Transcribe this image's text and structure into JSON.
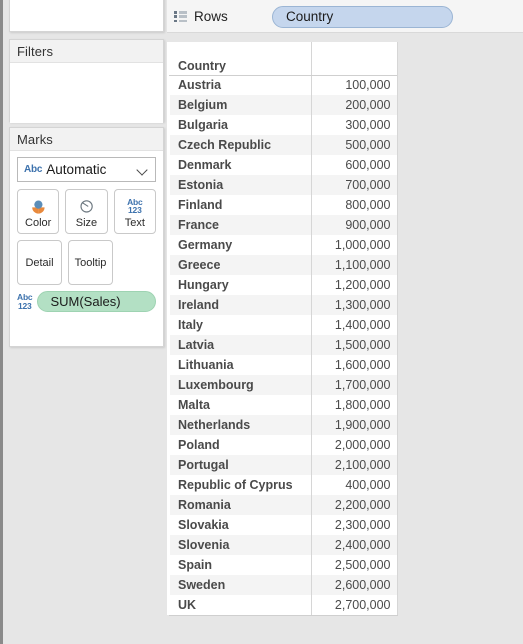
{
  "left_panel": {
    "pages_card": {
      "title": ""
    },
    "filters_card": {
      "title": "Filters"
    },
    "marks_card": {
      "title": "Marks",
      "mark_type": {
        "icon_label": "Abc",
        "value": "Automatic",
        "chevron": "chevron-down-icon"
      },
      "buttons": [
        {
          "name": "color",
          "label": "Color",
          "icon": "color-palette-icon"
        },
        {
          "name": "size",
          "label": "Size",
          "icon": "size-circle-icon"
        },
        {
          "name": "text",
          "label": "Text",
          "icon": "abc123-icon",
          "icon_line1": "Abc",
          "icon_line2": "123"
        },
        {
          "name": "detail",
          "label": "Detail",
          "icon": "none"
        },
        {
          "name": "tooltip",
          "label": "Tooltip",
          "icon": "none"
        }
      ],
      "pill": {
        "icon_line1": "Abc",
        "icon_line2": "123",
        "label": "SUM(Sales)",
        "color": "#b3e0c4"
      }
    }
  },
  "rows_shelf": {
    "icon": "rows-list-icon",
    "label": "Rows",
    "pill": {
      "label": "Country",
      "color": "#c5d6ed"
    }
  },
  "crosstab": {
    "header": {
      "dimension": "Country",
      "measure": ""
    },
    "rows": [
      {
        "country": "Austria",
        "sales": "100,000"
      },
      {
        "country": "Belgium",
        "sales": "200,000"
      },
      {
        "country": "Bulgaria",
        "sales": "300,000"
      },
      {
        "country": "Czech Republic",
        "sales": "500,000"
      },
      {
        "country": "Denmark",
        "sales": "600,000"
      },
      {
        "country": "Estonia",
        "sales": "700,000"
      },
      {
        "country": "Finland",
        "sales": "800,000"
      },
      {
        "country": "France",
        "sales": "900,000"
      },
      {
        "country": "Germany",
        "sales": "1,000,000"
      },
      {
        "country": "Greece",
        "sales": "1,100,000"
      },
      {
        "country": "Hungary",
        "sales": "1,200,000"
      },
      {
        "country": "Ireland",
        "sales": "1,300,000"
      },
      {
        "country": "Italy",
        "sales": "1,400,000"
      },
      {
        "country": "Latvia",
        "sales": "1,500,000"
      },
      {
        "country": "Lithuania",
        "sales": "1,600,000"
      },
      {
        "country": "Luxembourg",
        "sales": "1,700,000"
      },
      {
        "country": "Malta",
        "sales": "1,800,000"
      },
      {
        "country": "Netherlands",
        "sales": "1,900,000"
      },
      {
        "country": "Poland",
        "sales": "2,000,000"
      },
      {
        "country": "Portugal",
        "sales": "2,100,000"
      },
      {
        "country": "Republic of Cyprus",
        "sales": "400,000"
      },
      {
        "country": "Romania",
        "sales": "2,200,000"
      },
      {
        "country": "Slovakia",
        "sales": "2,300,000"
      },
      {
        "country": "Slovenia",
        "sales": "2,400,000"
      },
      {
        "country": "Spain",
        "sales": "2,500,000"
      },
      {
        "country": "Sweden",
        "sales": "2,600,000"
      },
      {
        "country": "UK",
        "sales": "2,700,000"
      }
    ]
  },
  "colors": {
    "canvas": "#e6e6e6",
    "card": "#ffffff",
    "card_header": "#f2f2f2",
    "pill_blue": "#c5d6ed",
    "pill_green": "#b3e0c4",
    "text": "#4a4a4a",
    "accent_blue": "#3d72ad",
    "accent_orange": "#e8893c"
  }
}
